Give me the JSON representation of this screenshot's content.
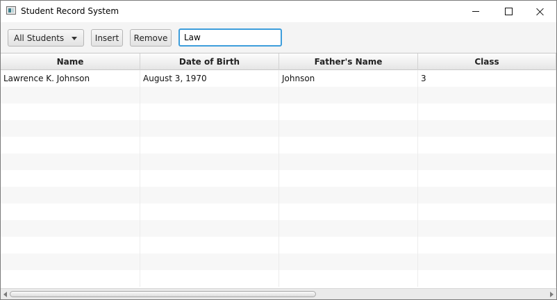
{
  "window": {
    "title": "Student Record System"
  },
  "toolbar": {
    "filter_selected": "All Students",
    "insert_label": "Insert",
    "remove_label": "Remove",
    "search_value": "Law"
  },
  "table": {
    "columns": [
      "Name",
      "Date of Birth",
      "Father's Name",
      "Class"
    ],
    "rows": [
      [
        "Lawrence K. Johnson",
        "August 3, 1970",
        "Johnson",
        "3"
      ]
    ]
  },
  "colors": {
    "focus_border": "#3d9ddb",
    "row_stripe": "#f7f7f7"
  }
}
